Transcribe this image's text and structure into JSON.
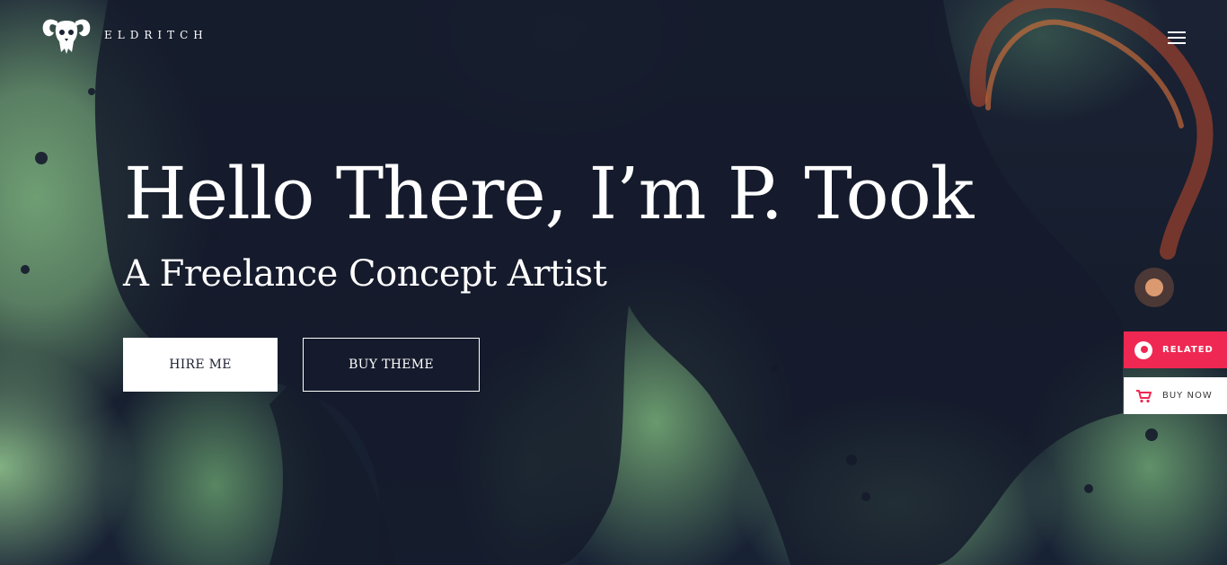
{
  "header": {
    "brand_name": "ELDRITCH",
    "logo_icon": "ram-skull-logo-icon",
    "menu_icon": "hamburger-menu-icon"
  },
  "hero": {
    "title": "Hello There, I’m P. Took",
    "subtitle": "A Freelance Concept Artist",
    "buttons": {
      "hire_label": "HIRE ME",
      "buy_theme_label": "BUY THEME"
    }
  },
  "side_widget": {
    "related_label": "RELATED",
    "related_icon": "related-circle-icon",
    "buy_now_label": "BUY NOW",
    "buy_now_icon": "shopping-cart-icon"
  },
  "colors": {
    "accent": "#ee2852",
    "background_dark": "#161d2d",
    "background_green": "#7aa97a",
    "text": "#ffffff"
  }
}
